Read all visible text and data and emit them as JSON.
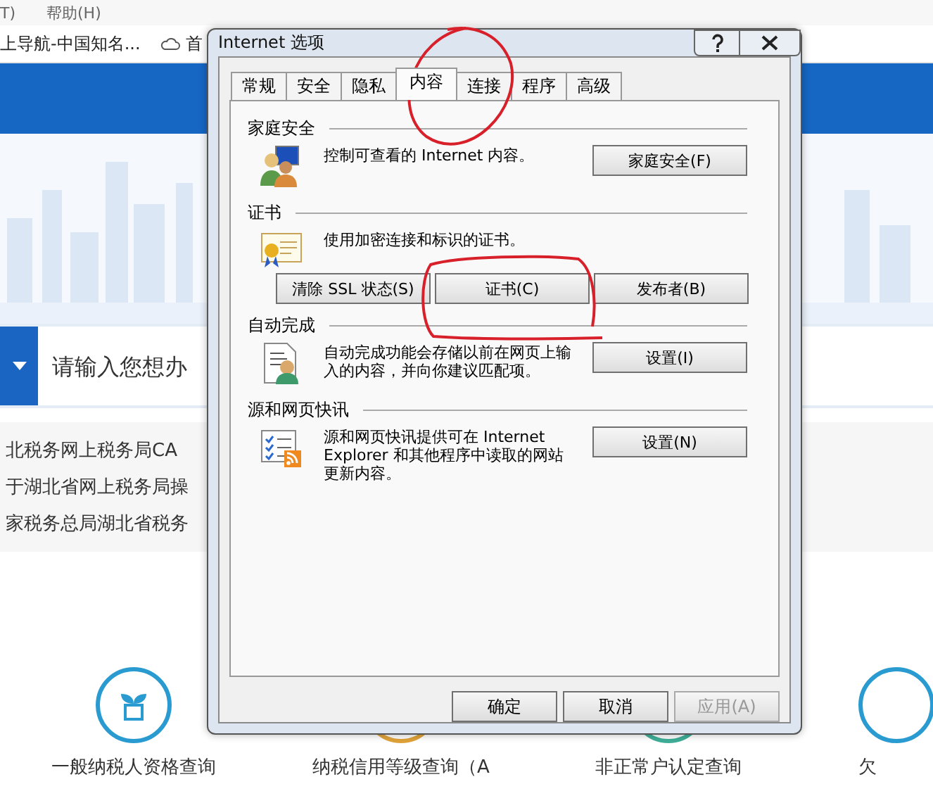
{
  "browser": {
    "menu": [
      "T)",
      "帮助(H)"
    ],
    "bookmarks": [
      {
        "label": "上导航-中国知名...",
        "kind": "text"
      },
      {
        "label": "首",
        "kind": "cloud"
      }
    ]
  },
  "site": {
    "search": {
      "placeholder": "请输入您想办"
    },
    "news": [
      "北税务网上税务局CA",
      "于湖北省网上税务局操",
      "家税务总局湖北省税务"
    ],
    "services": [
      {
        "label": "一般纳税人资格查询",
        "color": "#2a9bd0",
        "kind": "plant"
      },
      {
        "label": "纳税信用等级查询（A",
        "color": "#e0a33a"
      },
      {
        "label": "非正常户认定查询",
        "color": "#3fae98"
      },
      {
        "label": "欠",
        "color": "#2a9bd0"
      }
    ]
  },
  "dialog": {
    "title": "Internet 选项",
    "tabs": [
      {
        "label": "常规",
        "selected": false
      },
      {
        "label": "安全",
        "selected": false
      },
      {
        "label": "隐私",
        "selected": false
      },
      {
        "label": "内容",
        "selected": true
      },
      {
        "label": "连接",
        "selected": false
      },
      {
        "label": "程序",
        "selected": false
      },
      {
        "label": "高级",
        "selected": false
      }
    ],
    "sections": [
      {
        "title": "家庭安全",
        "kind": "family",
        "description": "控制可查看的 Internet 内容。",
        "buttons": [
          "家庭安全(F)"
        ]
      },
      {
        "title": "证书",
        "kind": "certificate",
        "description": "使用加密连接和标识的证书。",
        "buttons": [
          "清除 SSL 状态(S)",
          "证书(C)",
          "发布者(B)"
        ]
      },
      {
        "title": "自动完成",
        "kind": "autocomplete",
        "description": "自动完成功能会存储以前在网页上输入的内容，并向你建议匹配项。",
        "buttons": [
          "设置(I)"
        ]
      },
      {
        "title": "源和网页快讯",
        "kind": "feeds",
        "description": "源和网页快讯提供可在 Internet Explorer 和其他程序中读取的网站更新内容。",
        "buttons": [
          "设置(N)"
        ]
      }
    ],
    "footer_buttons": [
      {
        "label": "确定",
        "disabled": false
      },
      {
        "label": "取消",
        "disabled": false
      },
      {
        "label": "应用(A)",
        "disabled": true
      }
    ]
  }
}
